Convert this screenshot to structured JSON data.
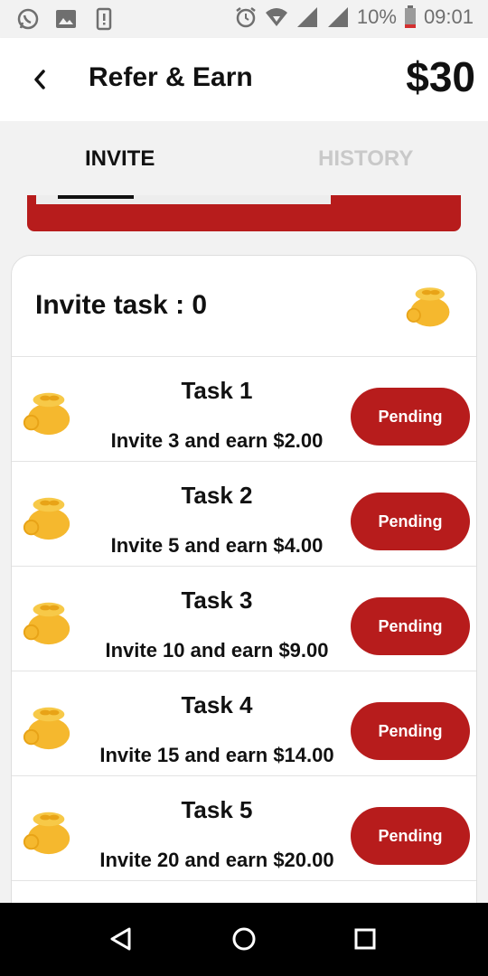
{
  "status_bar": {
    "battery": "10%",
    "time": "09:01",
    "left_icons": [
      "whatsapp-icon",
      "image-icon",
      "alert-phone-icon"
    ],
    "right_icons": [
      "alarm-icon",
      "wifi-icon",
      "signal-icon",
      "signal-icon",
      "battery-icon"
    ]
  },
  "app_bar": {
    "title": "Refer & Earn",
    "balance": "$30",
    "back_icon": "chevron-left-icon"
  },
  "tabs": [
    {
      "label": "INVITE",
      "active": true
    },
    {
      "label": "HISTORY",
      "active": false
    }
  ],
  "invite_card": {
    "title": "Invite task : 0",
    "icon": "money-bag-icon"
  },
  "tasks": [
    {
      "name": "Task 1",
      "description": "Invite 3 and earn $2.00",
      "status": "Pending"
    },
    {
      "name": "Task 2",
      "description": "Invite 5 and earn $4.00",
      "status": "Pending"
    },
    {
      "name": "Task 3",
      "description": "Invite 10 and earn $9.00",
      "status": "Pending"
    },
    {
      "name": "Task 4",
      "description": "Invite 15 and earn $14.00",
      "status": "Pending"
    },
    {
      "name": "Task 5",
      "description": "Invite 20 and earn $20.00",
      "status": "Pending"
    }
  ],
  "colors": {
    "accent": "#b71c1c",
    "bag": "#f5b82e",
    "tab_inactive": "#c9c9c9"
  },
  "nav_bar": [
    "back-triangle-icon",
    "home-circle-icon",
    "recents-square-icon"
  ]
}
